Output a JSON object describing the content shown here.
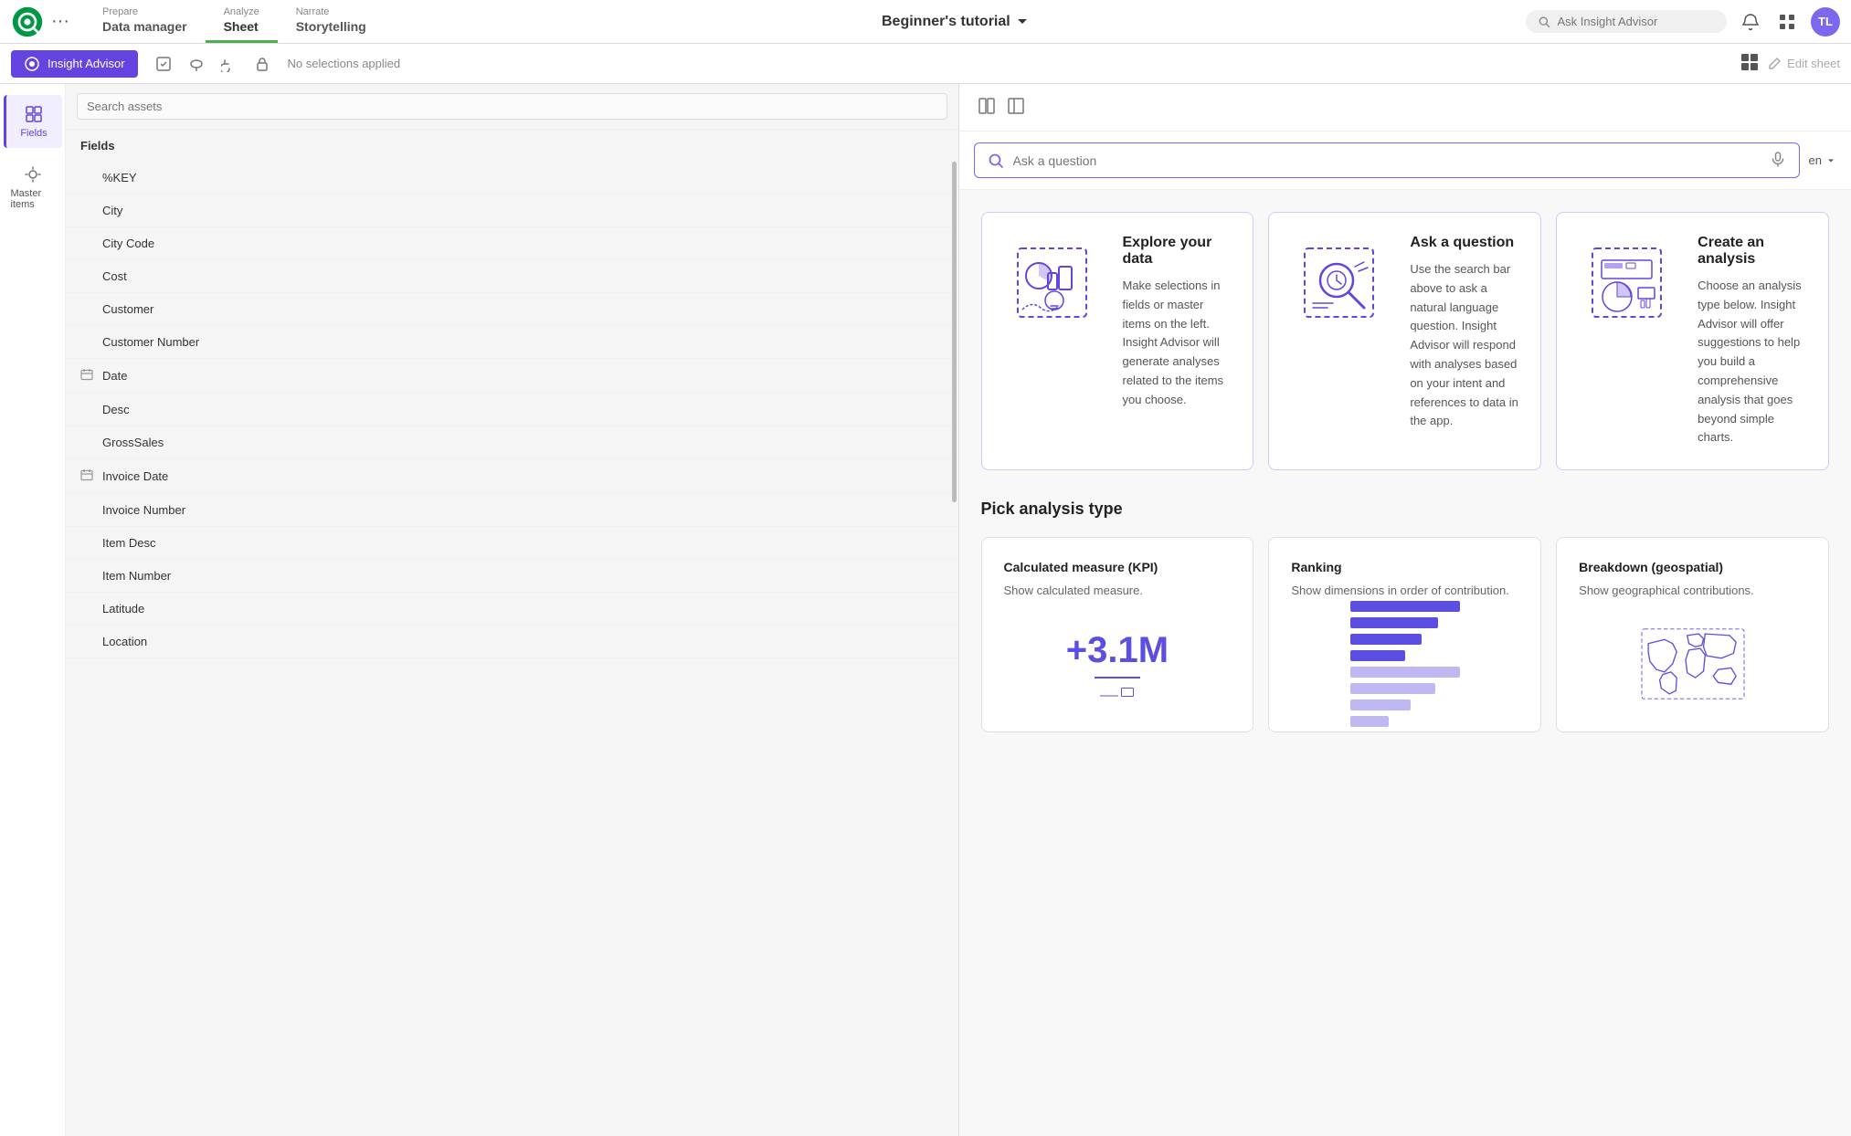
{
  "topNav": {
    "tabs": [
      {
        "id": "prepare",
        "sub": "Prepare",
        "main": "Data manager",
        "active": false
      },
      {
        "id": "analyze",
        "sub": "Analyze",
        "main": "Sheet",
        "active": true
      },
      {
        "id": "narrate",
        "sub": "Narrate",
        "main": "Storytelling",
        "active": false
      }
    ],
    "appTitle": "Beginner's tutorial",
    "searchPlaceholder": "Ask Insight Advisor",
    "avatar": "TL"
  },
  "secondaryToolbar": {
    "insightAdvisorLabel": "Insight Advisor",
    "noSelectionsLabel": "No selections applied",
    "editSheetLabel": "Edit sheet"
  },
  "leftPanel": {
    "title": "Insight Advisor",
    "sidebarItems": [
      {
        "id": "fields",
        "label": "Fields",
        "active": true
      },
      {
        "id": "master-items",
        "label": "Master items",
        "active": false
      }
    ],
    "searchPlaceholder": "Search assets",
    "fieldsHeader": "Fields",
    "fields": [
      {
        "id": "percent-key",
        "label": "%KEY",
        "hasIcon": false
      },
      {
        "id": "city",
        "label": "City",
        "hasIcon": false
      },
      {
        "id": "city-code",
        "label": "City Code",
        "hasIcon": false
      },
      {
        "id": "cost",
        "label": "Cost",
        "hasIcon": false
      },
      {
        "id": "customer",
        "label": "Customer",
        "hasIcon": false
      },
      {
        "id": "customer-number",
        "label": "Customer Number",
        "hasIcon": false
      },
      {
        "id": "date",
        "label": "Date",
        "hasIcon": true
      },
      {
        "id": "desc",
        "label": "Desc",
        "hasIcon": false
      },
      {
        "id": "gross-sales",
        "label": "GrossSales",
        "hasIcon": false
      },
      {
        "id": "invoice-date",
        "label": "Invoice Date",
        "hasIcon": true
      },
      {
        "id": "invoice-number",
        "label": "Invoice Number",
        "hasIcon": false
      },
      {
        "id": "item-desc",
        "label": "Item Desc",
        "hasIcon": false
      },
      {
        "id": "item-number",
        "label": "Item Number",
        "hasIcon": false
      },
      {
        "id": "latitude",
        "label": "Latitude",
        "hasIcon": false
      },
      {
        "id": "location",
        "label": "Location",
        "hasIcon": false
      }
    ]
  },
  "askBar": {
    "placeholder": "Ask a question",
    "language": "en"
  },
  "infoCards": [
    {
      "id": "explore",
      "title": "Explore your data",
      "description": "Make selections in fields or master items on the left. Insight Advisor will generate analyses related to the items you choose."
    },
    {
      "id": "ask",
      "title": "Ask a question",
      "description": "Use the search bar above to ask a natural language question. Insight Advisor will respond with analyses based on your intent and references to data in the app."
    },
    {
      "id": "create",
      "title": "Create an analysis",
      "description": "Choose an analysis type below. Insight Advisor will offer suggestions to help you build a comprehensive analysis that goes beyond simple charts."
    }
  ],
  "analysisSection": {
    "title": "Pick analysis type",
    "cards": [
      {
        "id": "kpi",
        "title": "Calculated measure (KPI)",
        "description": "Show calculated measure.",
        "kpiValue": "+3.1M"
      },
      {
        "id": "ranking",
        "title": "Ranking",
        "description": "Show dimensions in order of contribution."
      },
      {
        "id": "geospatial",
        "title": "Breakdown (geospatial)",
        "description": "Show geographical contributions."
      }
    ]
  }
}
